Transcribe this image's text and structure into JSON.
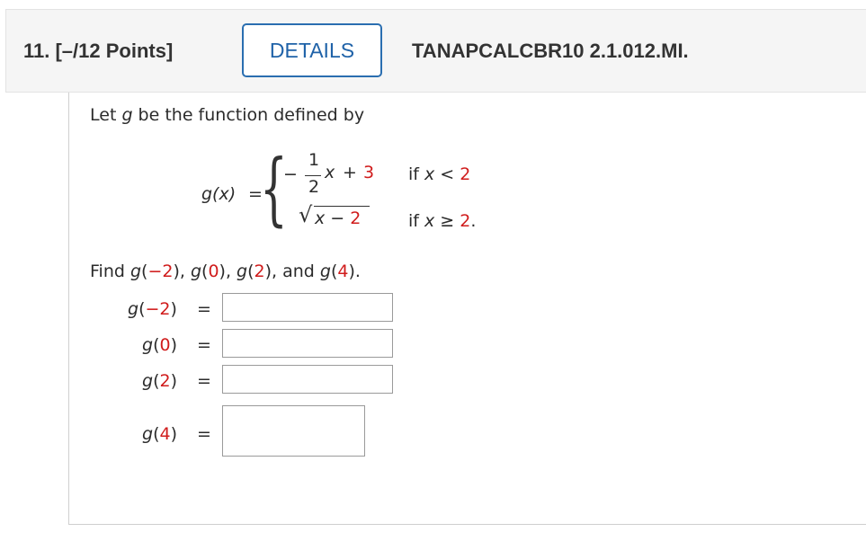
{
  "header": {
    "question_number": "11. [–/12 Points]",
    "details_label": "DETAILS",
    "course_code": "TANAPCALCBR10 2.1.012.MI."
  },
  "problem": {
    "intro_prefix": "Let ",
    "intro_var": "g",
    "intro_suffix": " be the function defined by",
    "function_name": "g(x)",
    "equals": "=",
    "piece1": {
      "minus": "−",
      "numerator": "1",
      "denominator": "2",
      "var": "x",
      "plus": "+",
      "constant": "3",
      "condition_prefix": "if ",
      "condition_var": "x",
      "condition_op": " < ",
      "condition_value": "2"
    },
    "piece2": {
      "radicand_var": "x",
      "minus": " − ",
      "radicand_const": "2",
      "condition_prefix": "if ",
      "condition_var": "x",
      "condition_op": " ≥ ",
      "condition_value": "2",
      "condition_suffix": "."
    },
    "find_prefix": "Find ",
    "find_args": [
      "−2",
      "0",
      "2",
      "4"
    ],
    "find_and": "and",
    "find_suffix": ")."
  },
  "answers": [
    {
      "arg": "−2",
      "value": ""
    },
    {
      "arg": "0",
      "value": ""
    },
    {
      "arg": "2",
      "value": ""
    },
    {
      "arg": "4",
      "value": ""
    }
  ]
}
